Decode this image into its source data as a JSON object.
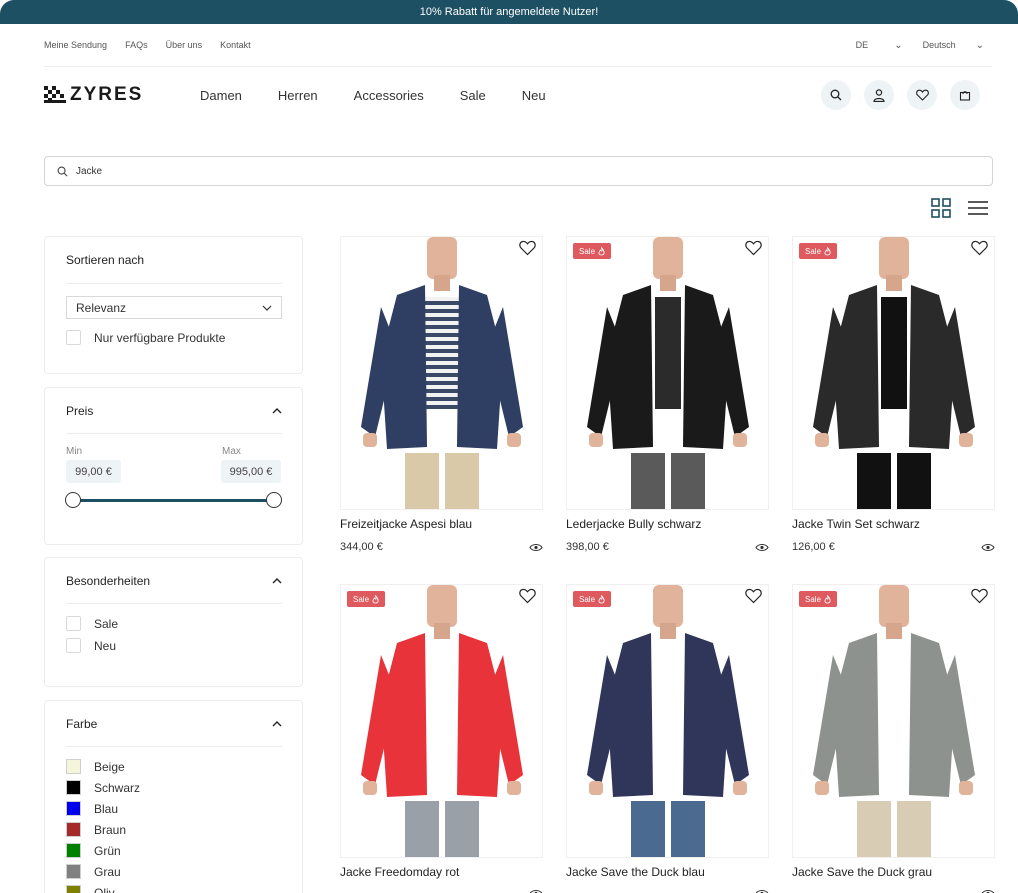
{
  "promo": "10% Rabatt für angemeldete Nutzer!",
  "utility": {
    "links": [
      "Meine Sendung",
      "FAQs",
      "Über uns",
      "Kontakt"
    ],
    "country": "DE",
    "language": "Deutsch"
  },
  "logo": "ZYRES",
  "nav": [
    "Damen",
    "Herren",
    "Accessories",
    "Sale",
    "Neu"
  ],
  "header_icons": [
    "search-icon",
    "user-icon",
    "heart-icon",
    "bag-icon"
  ],
  "search": {
    "value": "Jacke"
  },
  "sort": {
    "title": "Sortieren nach",
    "selected": "Relevanz",
    "available_only": "Nur verfügbare Produkte"
  },
  "price": {
    "title": "Preis",
    "min_label": "Min",
    "max_label": "Max",
    "min_value": "99,00 €",
    "max_value": "995,00 €",
    "range_fill": [
      0,
      1
    ]
  },
  "features": {
    "title": "Besonderheiten",
    "options": [
      "Sale",
      "Neu"
    ]
  },
  "colors": {
    "title": "Farbe",
    "options": [
      {
        "label": "Beige",
        "hex": "#f5f5dc"
      },
      {
        "label": "Schwarz",
        "hex": "#000000"
      },
      {
        "label": "Blau",
        "hex": "#0000ee"
      },
      {
        "label": "Braun",
        "hex": "#a52a2a"
      },
      {
        "label": "Grün",
        "hex": "#008000"
      },
      {
        "label": "Grau",
        "hex": "#808080"
      },
      {
        "label": "Oliv",
        "hex": "#808000"
      }
    ]
  },
  "sale_badge": "Sale",
  "products": [
    {
      "name": "Freizeitjacke Aspesi blau",
      "price": "344,00 €",
      "sale": false,
      "jacket": "#2f3f63",
      "shirt": "stripes",
      "pants": "#d9c9a8"
    },
    {
      "name": "Lederjacke Bully schwarz",
      "price": "398,00 €",
      "sale": true,
      "jacket": "#1a1a1a",
      "shirt": "#2b2b2b",
      "pants": "#5a5a5a"
    },
    {
      "name": "Jacke Twin Set schwarz",
      "price": "126,00 €",
      "sale": true,
      "jacket": "#2a2a2a",
      "shirt": "#111111",
      "pants": "#111111"
    },
    {
      "name": "Jacke Freedomday rot",
      "price": "",
      "sale": true,
      "jacket": "#e8333a",
      "shirt": "#ffffff",
      "pants": "#9aa0a8"
    },
    {
      "name": "Jacke Save the Duck blau",
      "price": "",
      "sale": true,
      "jacket": "#30365a",
      "shirt": "#ffffff",
      "pants": "#4a6a90"
    },
    {
      "name": "Jacke Save the Duck grau",
      "price": "",
      "sale": true,
      "jacket": "#8d928e",
      "shirt": "#ffffff",
      "pants": "#d8ccb4"
    }
  ],
  "accent": "#1d5063",
  "sale_color": "#de5a5f"
}
